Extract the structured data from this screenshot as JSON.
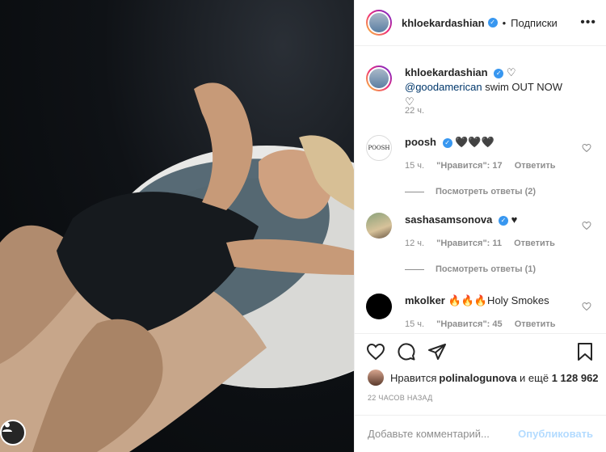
{
  "post": {
    "username": "khloekardashian",
    "separator": "•",
    "follow_status": "Подписки",
    "more_icon": "more-icon"
  },
  "caption": {
    "username": "khloekardashian",
    "heart": "♡",
    "mention": "@goodamerican",
    "text": " swim OUT NOW ♡",
    "time": "22 ч."
  },
  "comments": [
    {
      "username": "poosh",
      "avatar_text": "POOSH",
      "text": "🖤🖤🖤",
      "time": "15 ч.",
      "likes": "\"Нравится\": 17",
      "reply": "Ответить",
      "view_replies": "Посмотреть ответы (2)",
      "verified": true
    },
    {
      "username": "sashasamsonova",
      "text": "♥",
      "time": "12 ч.",
      "likes": "\"Нравится\": 11",
      "reply": "Ответить",
      "view_replies": "Посмотреть ответы (1)",
      "verified": true
    },
    {
      "username": "mkolker",
      "text": "🔥🔥🔥Holy Smokes",
      "time": "15 ч.",
      "likes": "\"Нравится\": 45",
      "reply": "Ответить",
      "verified": false
    }
  ],
  "likes": {
    "prefix": "Нравится ",
    "user": "polinalogunova",
    "middle": " и ещё ",
    "count": "1 128 962"
  },
  "posted_ago": "22 ЧАСОВ НАЗАД",
  "add_comment": {
    "placeholder": "Добавьте комментарий...",
    "publish": "Опубликовать"
  },
  "colors": {
    "verified": "#3897f0",
    "publish_disabled": "#b3dbff",
    "muted": "#8e8e8e"
  }
}
